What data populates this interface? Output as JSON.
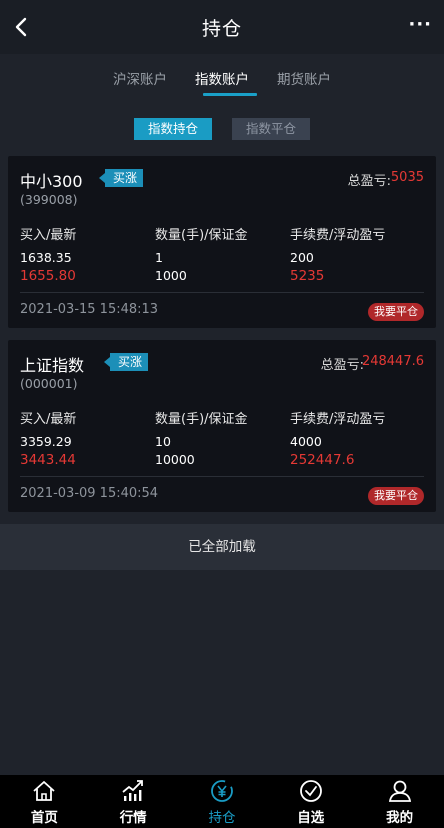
{
  "header": {
    "title": "持仓",
    "more": "···"
  },
  "account_tabs": [
    "沪深账户",
    "指数账户",
    "期货账户"
  ],
  "sub_tabs": [
    "指数持仓",
    "指数平仓"
  ],
  "column_headers": [
    "买入/最新",
    "数量(手)/保证金",
    "手续费/浮动盈亏"
  ],
  "positions": [
    {
      "name": "中小300",
      "badge": "买涨",
      "code": "(399008)",
      "pl_label": "总盈亏:",
      "pl_value": "5035",
      "buy": "1638.35",
      "latest": "1655.80",
      "qty": "1",
      "margin": "1000",
      "fee": "200",
      "float_pl": "5235",
      "time": "2021-03-15 15:48:13",
      "close_label": "我要平仓"
    },
    {
      "name": "上证指数",
      "badge": "买涨",
      "code": "(000001)",
      "pl_label": "总盈亏:",
      "pl_value": "248447.6",
      "buy": "3359.29",
      "latest": "3443.44",
      "qty": "10",
      "margin": "10000",
      "fee": "4000",
      "float_pl": "252447.6",
      "time": "2021-03-09 15:40:54",
      "close_label": "我要平仓"
    }
  ],
  "loaded_text": "已全部加载",
  "bottom_nav": [
    "首页",
    "行情",
    "持仓",
    "自选",
    "我的"
  ],
  "colors": {
    "accent": "#1a9cc4",
    "loss_red": "#e53935",
    "close_button": "#b0282a"
  }
}
